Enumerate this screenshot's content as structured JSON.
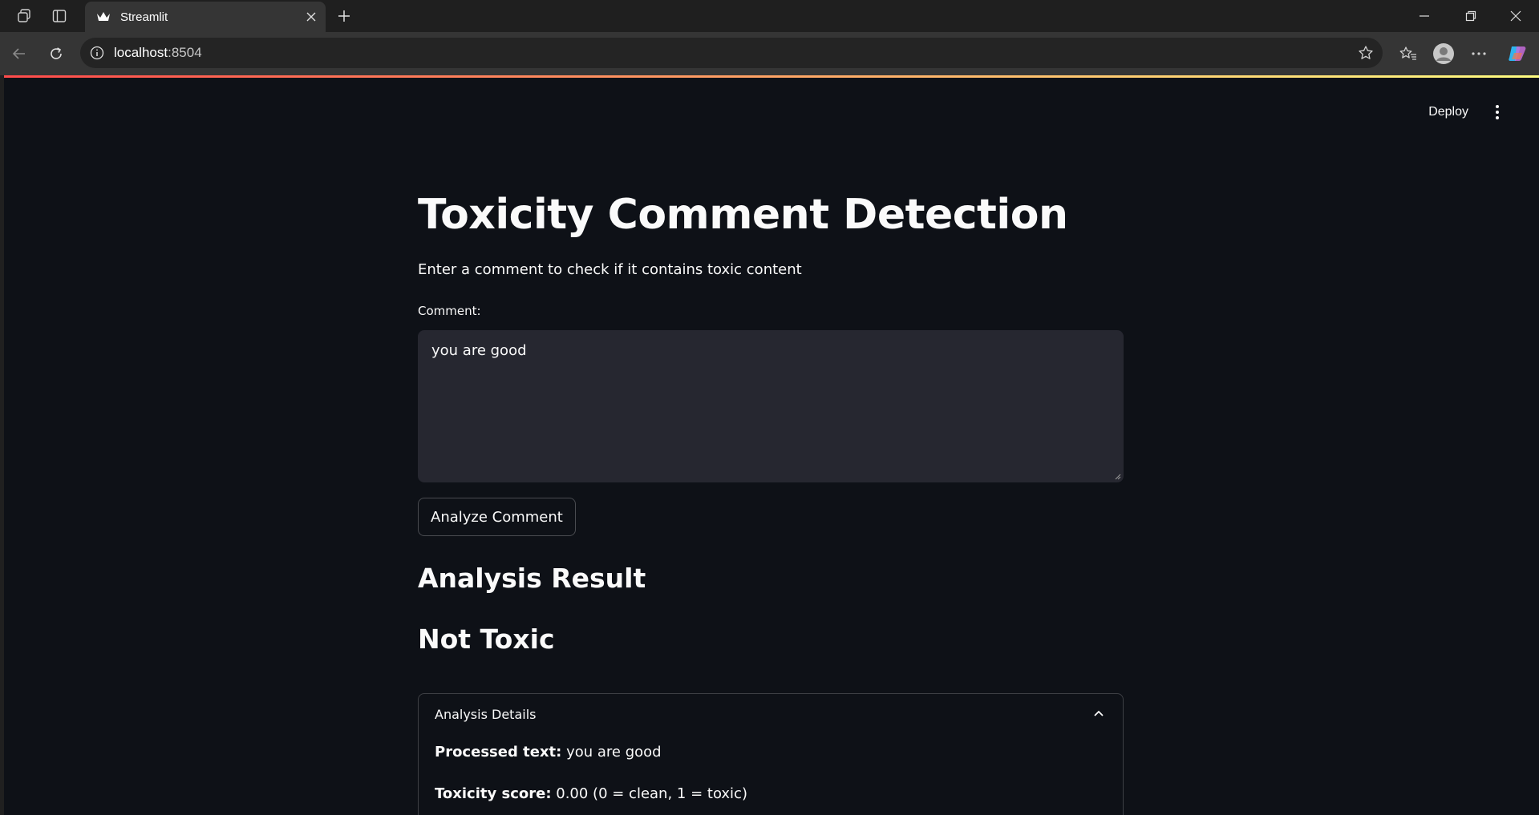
{
  "browser": {
    "tab_title": "Streamlit",
    "url_host": "localhost",
    "url_port": ":8504",
    "icons": [
      "workspaces-icon",
      "vertical-tabs-icon",
      "streamlit-crown-icon",
      "close-icon",
      "new-tab-icon",
      "minimize-icon",
      "restore-icon",
      "window-close-icon",
      "back-icon",
      "refresh-icon",
      "info-icon",
      "favorite-star-icon",
      "favorites-icon",
      "profile-icon",
      "more-icon",
      "copilot-icon"
    ]
  },
  "app": {
    "deploy_label": "Deploy",
    "title": "Toxicity Comment Detection",
    "subtitle": "Enter a comment to check if it contains toxic content",
    "comment_label": "Comment:",
    "comment_value": "you are good",
    "analyze_button": "Analyze Comment",
    "result_heading": "Analysis Result",
    "result_value": "Not Toxic",
    "details": {
      "title": "Analysis Details",
      "processed_label": "Processed text:",
      "processed_value": "you are good",
      "score_label": "Toxicity score:",
      "score_value": "0.00 (0 = clean, 1 = toxic)"
    },
    "colors": {
      "background": "#0e1117",
      "text": "#fafafa",
      "input_bg": "#262730",
      "deco_start": "#ff4b4b",
      "deco_end": "#fffd80"
    }
  }
}
